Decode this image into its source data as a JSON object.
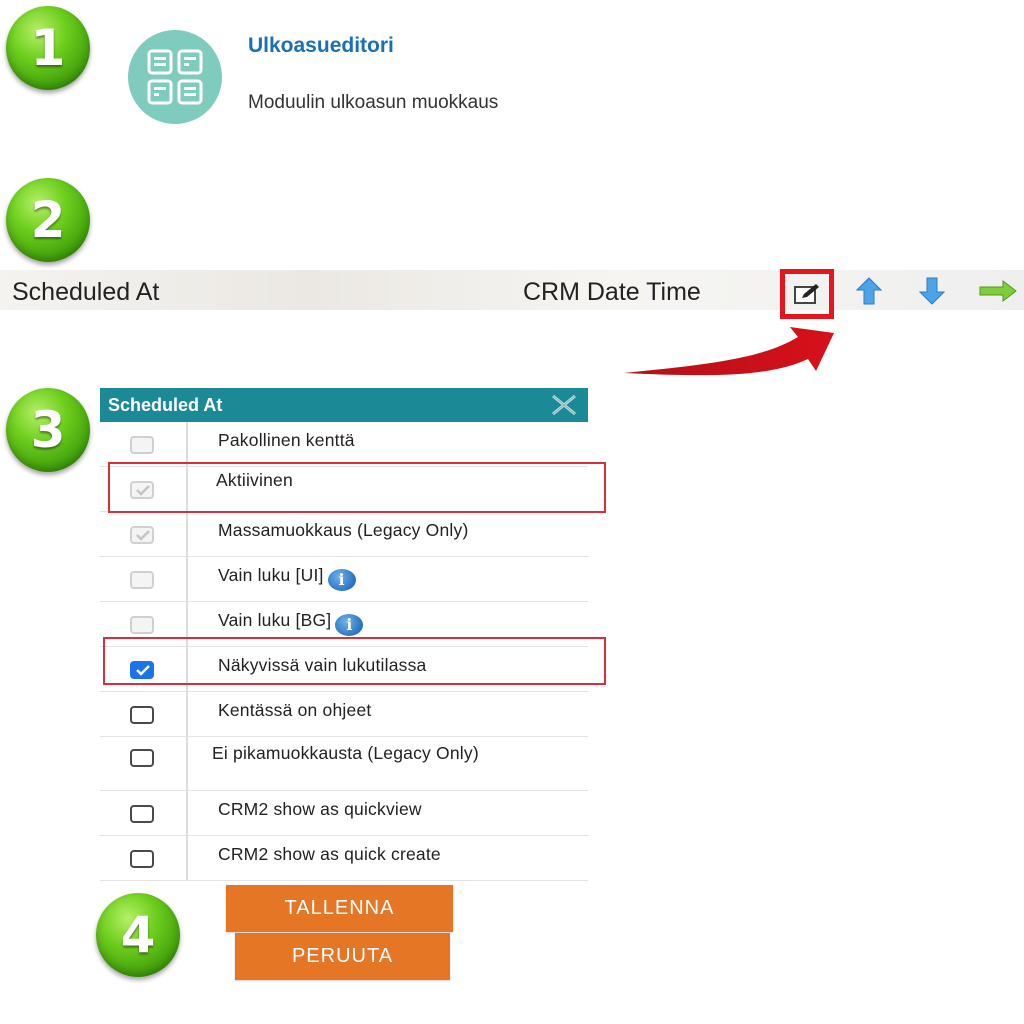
{
  "steps": [
    "1",
    "2",
    "3",
    "4"
  ],
  "module": {
    "title": "Ulkoasueditori",
    "description": "Moduulin ulkoasun muokkaus",
    "icon": "layout-grid-icon"
  },
  "field": {
    "name": "Scheduled At",
    "type": "CRM Date Time",
    "actions": [
      "edit-icon",
      "arrow-up-icon",
      "arrow-down-icon",
      "arrow-right-icon"
    ]
  },
  "dialog": {
    "title": "Scheduled At",
    "options": [
      {
        "label": "Pakollinen kenttä",
        "state": "disabled",
        "checked": false
      },
      {
        "label": "Aktiivinen",
        "state": "disabled",
        "checked": true
      },
      {
        "label": "Massamuokkaus (Legacy Only)",
        "state": "disabled",
        "checked": true
      },
      {
        "label": "Vain luku [UI]",
        "state": "disabled",
        "checked": false,
        "info": true
      },
      {
        "label": "Vain luku [BG]",
        "state": "disabled",
        "checked": false,
        "info": true
      },
      {
        "label": "Näkyvissä vain lukutilassa",
        "state": "enabled",
        "checked": true
      },
      {
        "label": "Kentässä on ohjeet",
        "state": "enabled",
        "checked": false
      },
      {
        "label": "Ei pikamuokkausta (Legacy Only)",
        "state": "enabled",
        "checked": false
      },
      {
        "label": "CRM2 show as quickview",
        "state": "enabled",
        "checked": false
      },
      {
        "label": "CRM2 show as quick create",
        "state": "enabled",
        "checked": false
      }
    ]
  },
  "buttons": {
    "save": "TALLENNA",
    "cancel": "PERUUTA"
  },
  "colors": {
    "step_green": "#4cb012",
    "dialog_header": "#1b8a96",
    "highlight": "#d72f3b",
    "button": "#e57626",
    "link": "#1a6fb5"
  }
}
